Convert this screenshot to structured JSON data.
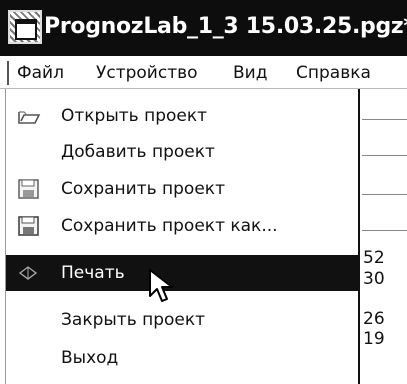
{
  "window": {
    "title": "PrognozLab_1_3 15.03.25.pgz*"
  },
  "menubar": {
    "items": [
      {
        "label": "Файл"
      },
      {
        "label": "Устройство"
      },
      {
        "label": "Вид"
      },
      {
        "label": "Справка"
      }
    ]
  },
  "file_menu": {
    "items": [
      {
        "label": "Открыть проект",
        "icon": "open-folder-icon"
      },
      {
        "label": "Добавить проект",
        "icon": ""
      },
      {
        "label": "Сохранить проект",
        "icon": "save-icon"
      },
      {
        "label": "Сохранить проект как...",
        "icon": "save-as-icon"
      },
      {
        "label": "Печать",
        "icon": "print-icon",
        "selected": true
      },
      {
        "label": "Закрыть проект",
        "icon": ""
      },
      {
        "label": "Выход",
        "icon": ""
      }
    ]
  },
  "background_values": [
    "52",
    "30",
    "26",
    "19"
  ]
}
